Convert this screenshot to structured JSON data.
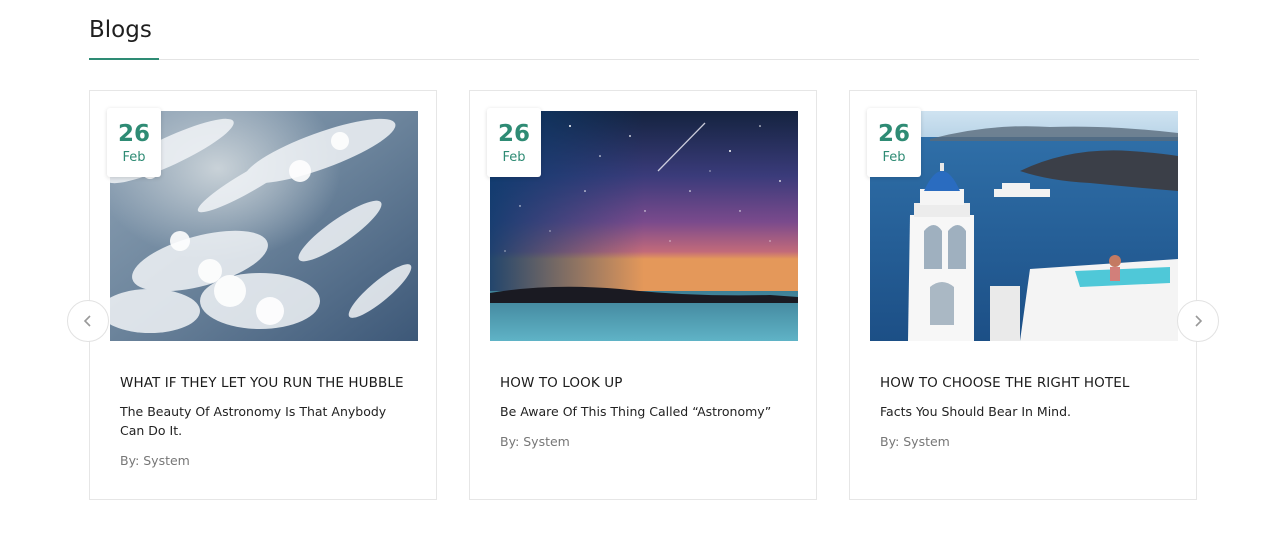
{
  "section": {
    "title": "Blogs"
  },
  "colors": {
    "accent": "#2e8b74",
    "border": "#e6e6e6",
    "muted": "#777777"
  },
  "carousel": {
    "prev_icon": "chevron-left-icon",
    "next_icon": "chevron-right-icon"
  },
  "posts": [
    {
      "day": "26",
      "month": "Feb",
      "title": "WHAT IF THEY LET YOU RUN THE HUBBLE",
      "description": "The Beauty Of Astronomy Is That Anybody Can Do It.",
      "author": "By: System",
      "image": "earth-clouds-from-orbit"
    },
    {
      "day": "26",
      "month": "Feb",
      "title": "HOW TO LOOK UP",
      "description": "Be Aware Of This Thing Called “Astronomy”",
      "author": "By: System",
      "image": "starry-night-sky-over-sea"
    },
    {
      "day": "26",
      "month": "Feb",
      "title": "HOW TO CHOOSE THE RIGHT HOTEL",
      "description": "Facts You Should Bear In Mind.",
      "author": "By: System",
      "image": "santorini-bell-tower-pool"
    }
  ]
}
